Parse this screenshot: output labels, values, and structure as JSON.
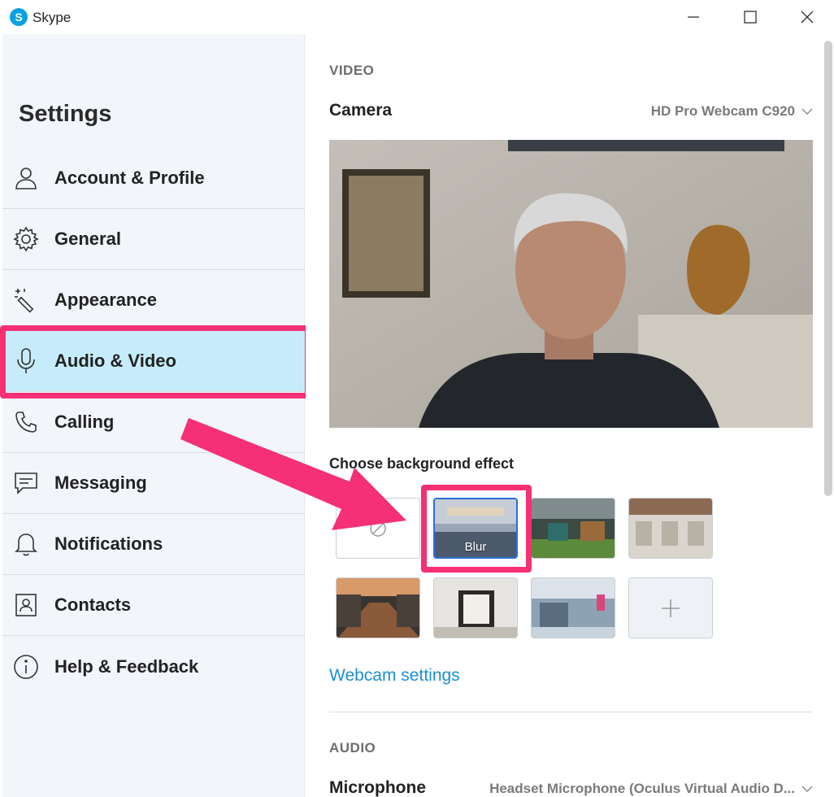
{
  "window": {
    "app_title": "Skype",
    "logo_glyph": "S",
    "buttons": [
      "minimize-icon",
      "maximize-icon",
      "close-icon"
    ]
  },
  "sidebar": {
    "title": "Settings",
    "items": [
      {
        "label": "Account & Profile",
        "icon": "person-icon"
      },
      {
        "label": "General",
        "icon": "gear-icon"
      },
      {
        "label": "Appearance",
        "icon": "magic-wand-icon"
      },
      {
        "label": "Audio & Video",
        "icon": "microphone-icon",
        "active": true
      },
      {
        "label": "Calling",
        "icon": "phone-icon"
      },
      {
        "label": "Messaging",
        "icon": "message-icon"
      },
      {
        "label": "Notifications",
        "icon": "bell-icon"
      },
      {
        "label": "Contacts",
        "icon": "contact-card-icon"
      },
      {
        "label": "Help & Feedback",
        "icon": "info-icon"
      }
    ]
  },
  "main": {
    "video_label": "VIDEO",
    "camera_label": "Camera",
    "camera_value": "HD Pro Webcam C920",
    "bg_effect_title": "Choose background effect",
    "blur_label": "Blur",
    "webcam_settings_link": "Webcam settings",
    "audio_label": "AUDIO",
    "microphone_label": "Microphone",
    "microphone_value": "Headset Microphone (Oculus Virtual Audio D..."
  },
  "colors": {
    "accent": "#1b8fd3",
    "highlight": "#f53075",
    "sidebar_bg": "#f2f5fa",
    "active_item_bg": "#c6ecfb"
  }
}
